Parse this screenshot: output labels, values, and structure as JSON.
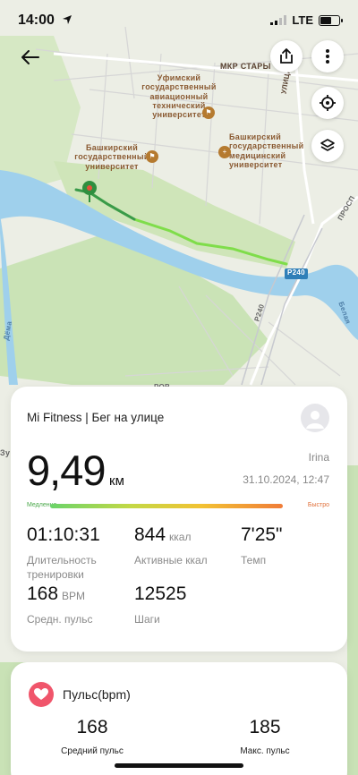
{
  "status_bar": {
    "time": "14:00",
    "network": "LTE"
  },
  "map": {
    "labels": {
      "district": "МКР СТАРЫ",
      "street": "УЛИЦА",
      "aviation_uni": "Уфимский\nгосударственный\nавиационный\nтехнический\nуниверситет",
      "state_uni": "Башкирский\nгосударственный\nуниверситет",
      "medical_uni": "Башкирский\nгосударственный\nмедицинский\nуниверситет",
      "road_r240": "Р240",
      "road_r240_vertical": "Р240",
      "river_belaya": "Белая",
      "river_dema": "Дёма",
      "road_prosp": "ПРОСП",
      "road_left": "РОВ",
      "left_edge": "Зу"
    }
  },
  "workout": {
    "title": "Mi Fitness | Бег на улице",
    "distance": "9,49",
    "distance_unit": "км",
    "user": "Irina",
    "datetime": "31.10.2024, 12:47",
    "pace_slow": "Медленно",
    "pace_fast": "Быстро",
    "stats": {
      "duration": {
        "value": "01:10:31",
        "label": "Длительность тренировки"
      },
      "calories": {
        "value": "844",
        "unit": "ккал",
        "label": "Активные ккал"
      },
      "pace": {
        "value": "7'25\"",
        "label": "Темп"
      },
      "avg_hr": {
        "value": "168",
        "unit": "BPM",
        "label": "Средн. пульс"
      },
      "steps": {
        "value": "12525",
        "label": "Шаги"
      }
    }
  },
  "heart_rate": {
    "title": "Пульс(bpm)",
    "avg_value": "168",
    "avg_label": "Средний пульс",
    "max_value": "185",
    "max_label": "Макс. пульс"
  },
  "colors": {
    "river": "#9fd0ec",
    "park": "#c9e2b6",
    "route_start": "#3a9a4a",
    "route_end": "#7fdd4a",
    "heart": "#f0556b",
    "road_sign": "#2f7fb8"
  },
  "icons": [
    "back-arrow-icon",
    "share-icon",
    "more-icon",
    "locate-icon",
    "layers-icon",
    "location-arrow-icon",
    "signal-icon",
    "battery-icon",
    "avatar-icon",
    "heart-icon",
    "start-pin-icon"
  ]
}
